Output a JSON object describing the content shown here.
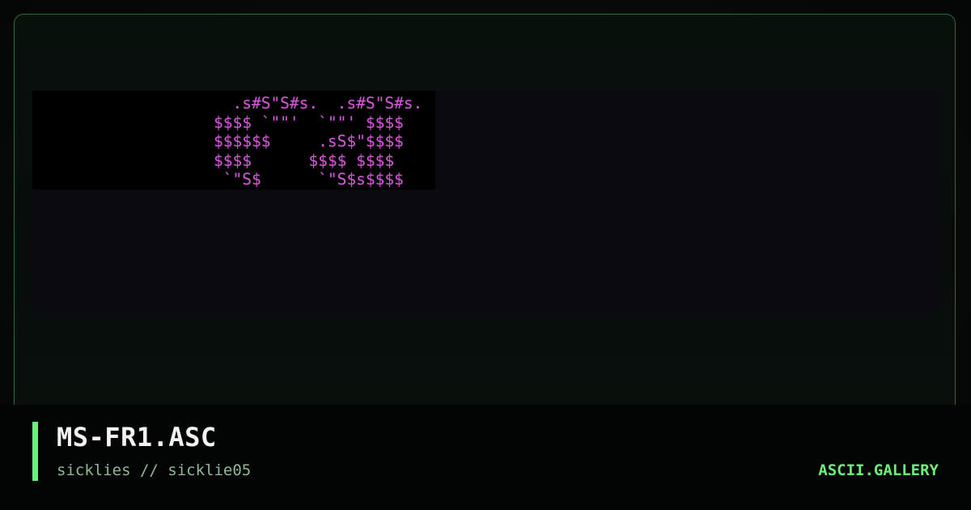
{
  "artwork": {
    "lines": [
      "  .s#S\"S#s.  .s#S\"S#s.",
      "$$$$ `\"\"'  `\"\"' $$$$",
      "$$$$$$     .sS$\"$$$$",
      "$$$$      $$$$ $$$$",
      " `\"S$      `\"S$s$$$$"
    ]
  },
  "footer": {
    "title": "MS-FR1.ASC",
    "subtitle": "sicklies // sicklie05",
    "brand": "ASCII.GALLERY"
  },
  "colors": {
    "accent": "#6cf07a",
    "frame_border": "#2f6b34",
    "art_magenta": "#d257d6",
    "title_text": "#f2f2f2",
    "subtitle_text": "#8fb996"
  }
}
